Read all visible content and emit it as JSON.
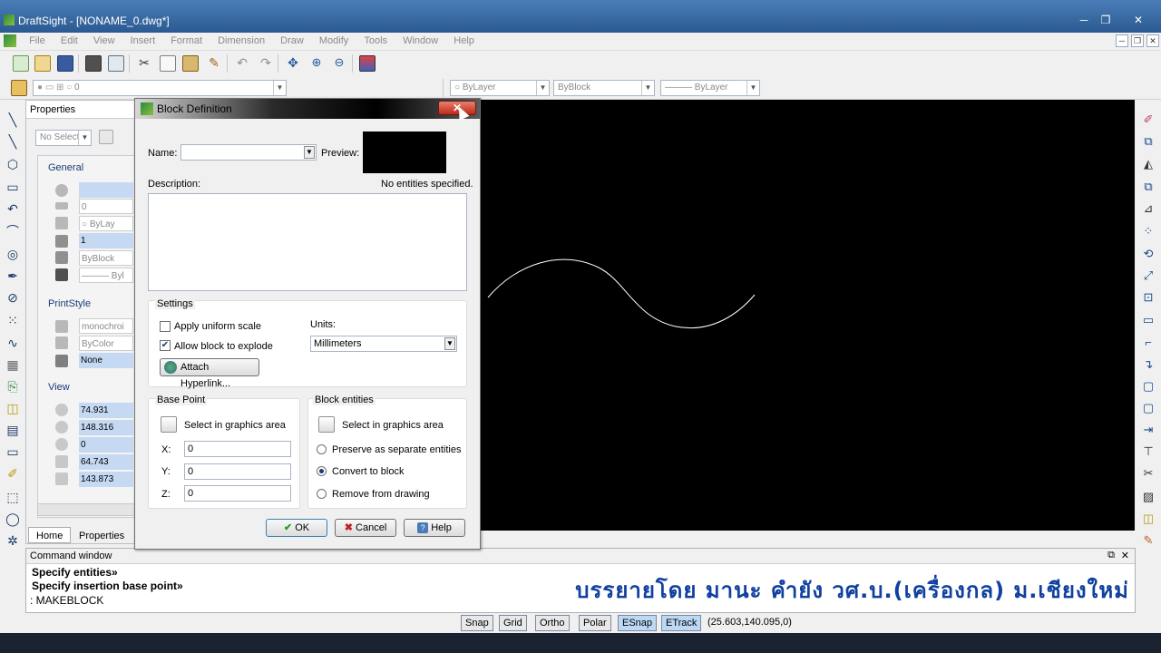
{
  "window": {
    "title": "DraftSight - [NONAME_0.dwg*]",
    "controls": [
      "─",
      "❐",
      "✕"
    ]
  },
  "menu": {
    "items": [
      "File",
      "Edit",
      "View",
      "Insert",
      "Format",
      "Dimension",
      "Draw",
      "Modify",
      "Tools",
      "Window",
      "Help"
    ]
  },
  "layerbar": {
    "layer_value": "0",
    "color": "ByLayer",
    "linetype": "ByBlock",
    "lineweight": "——— ByLayer"
  },
  "properties": {
    "title": "Properties",
    "selector": "No Select",
    "groups": {
      "general": "General",
      "printstyle": "PrintStyle",
      "view": "View"
    },
    "general_rows": [
      "",
      "0",
      "ByLay",
      "1",
      "ByBlock",
      "——— Byl"
    ],
    "printstyle_rows": [
      "monochroi",
      "ByColor",
      "None"
    ],
    "view_rows": [
      "74.931",
      "148.316",
      "0",
      "64.743",
      "143.873"
    ],
    "tabs": [
      "Home",
      "Properties"
    ]
  },
  "dialog": {
    "title": "Block Definition",
    "name_label": "Name:",
    "name_value": "",
    "preview_label": "Preview:",
    "description_label": "Description:",
    "no_entities": "No entities specified.",
    "settings_label": "Settings",
    "uniform_scale": "Apply uniform scale",
    "allow_explode": "Allow block to explode",
    "units_label": "Units:",
    "units_value": "Millimeters",
    "hyperlink": "Attach Hyperlink...",
    "base_point_label": "Base Point",
    "base_select": "Select in graphics area",
    "x_label": "X:",
    "y_label": "Y:",
    "z_label": "Z:",
    "x_value": "0",
    "y_value": "0",
    "z_value": "0",
    "block_entities_label": "Block entities",
    "block_select": "Select in graphics area",
    "opt_preserve": "Preserve as separate entities",
    "opt_convert": "Convert to block",
    "opt_remove": "Remove from drawing",
    "ok": "OK",
    "cancel": "Cancel",
    "help": "Help",
    "uniform_scale_checked": false,
    "allow_explode_checked": true,
    "selected_option": "Convert to block"
  },
  "command": {
    "title": "Command window",
    "lines": [
      "Specify entities»",
      "Specify insertion base point»"
    ],
    "prompt": ": MAKEBLOCK",
    "watermark": "บรรยายโดย มานะ คำยัง วศ.บ.(เครื่องกล) ม.เชียงใหม่"
  },
  "status": {
    "buttons": [
      "Snap",
      "Grid",
      "Ortho",
      "Polar",
      "ESnap",
      "ETrack"
    ],
    "active": [
      "ESnap",
      "ETrack"
    ],
    "coords": "(25.603,140.095,0)"
  },
  "colors": {
    "canvas": "#000000",
    "highlight": "#c6d9f3",
    "watermark": "#1040a0"
  }
}
